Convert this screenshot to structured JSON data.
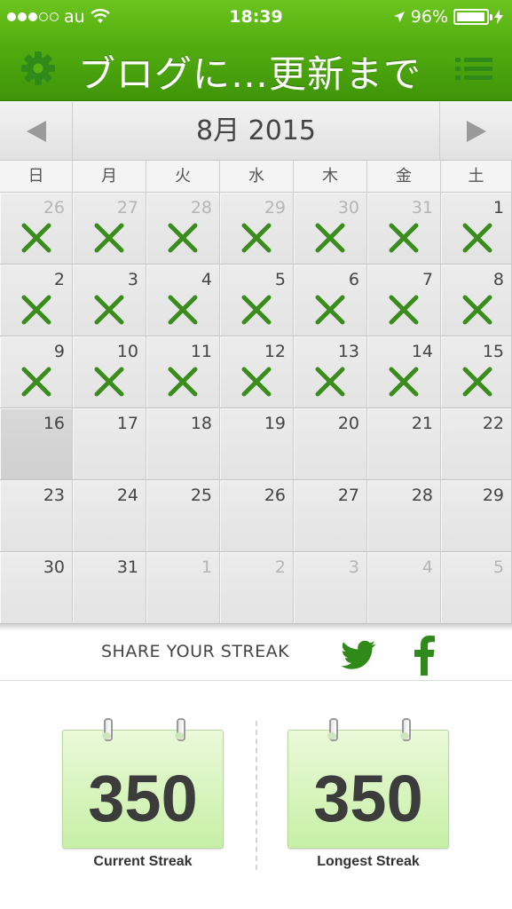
{
  "status_bar": {
    "carrier": "au",
    "time": "18:39",
    "battery": "96%",
    "battery_level": 0.96,
    "signal_bars": 3
  },
  "navbar": {
    "title": "ブログに…更新まで",
    "left_icon": "gear-icon",
    "right_icon": "list-icon"
  },
  "calendar": {
    "month_label": "8月 2015",
    "weekdays": [
      "日",
      "月",
      "火",
      "水",
      "木",
      "金",
      "土"
    ],
    "weeks": [
      [
        {
          "day": "26",
          "other": true,
          "marked": true
        },
        {
          "day": "27",
          "other": true,
          "marked": true
        },
        {
          "day": "28",
          "other": true,
          "marked": true
        },
        {
          "day": "29",
          "other": true,
          "marked": true
        },
        {
          "day": "30",
          "other": true,
          "marked": true
        },
        {
          "day": "31",
          "other": true,
          "marked": true
        },
        {
          "day": "1",
          "other": false,
          "marked": true
        }
      ],
      [
        {
          "day": "2",
          "other": false,
          "marked": true
        },
        {
          "day": "3",
          "other": false,
          "marked": true
        },
        {
          "day": "4",
          "other": false,
          "marked": true
        },
        {
          "day": "5",
          "other": false,
          "marked": true
        },
        {
          "day": "6",
          "other": false,
          "marked": true
        },
        {
          "day": "7",
          "other": false,
          "marked": true
        },
        {
          "day": "8",
          "other": false,
          "marked": true
        }
      ],
      [
        {
          "day": "9",
          "other": false,
          "marked": true
        },
        {
          "day": "10",
          "other": false,
          "marked": true
        },
        {
          "day": "11",
          "other": false,
          "marked": true
        },
        {
          "day": "12",
          "other": false,
          "marked": true
        },
        {
          "day": "13",
          "other": false,
          "marked": true
        },
        {
          "day": "14",
          "other": false,
          "marked": true
        },
        {
          "day": "15",
          "other": false,
          "marked": true
        }
      ],
      [
        {
          "day": "16",
          "other": false,
          "marked": false,
          "today": true
        },
        {
          "day": "17",
          "other": false,
          "marked": false
        },
        {
          "day": "18",
          "other": false,
          "marked": false
        },
        {
          "day": "19",
          "other": false,
          "marked": false
        },
        {
          "day": "20",
          "other": false,
          "marked": false
        },
        {
          "day": "21",
          "other": false,
          "marked": false
        },
        {
          "day": "22",
          "other": false,
          "marked": false
        }
      ],
      [
        {
          "day": "23",
          "other": false,
          "marked": false
        },
        {
          "day": "24",
          "other": false,
          "marked": false
        },
        {
          "day": "25",
          "other": false,
          "marked": false
        },
        {
          "day": "26",
          "other": false,
          "marked": false
        },
        {
          "day": "27",
          "other": false,
          "marked": false
        },
        {
          "day": "28",
          "other": false,
          "marked": false
        },
        {
          "day": "29",
          "other": false,
          "marked": false
        }
      ],
      [
        {
          "day": "30",
          "other": false,
          "marked": false
        },
        {
          "day": "31",
          "other": false,
          "marked": false
        },
        {
          "day": "1",
          "other": true,
          "marked": false
        },
        {
          "day": "2",
          "other": true,
          "marked": false
        },
        {
          "day": "3",
          "other": true,
          "marked": false
        },
        {
          "day": "4",
          "other": true,
          "marked": false
        },
        {
          "day": "5",
          "other": true,
          "marked": false
        }
      ]
    ]
  },
  "share": {
    "label": "SHARE YOUR STREAK",
    "twitter_icon": "twitter-icon",
    "facebook_icon": "facebook-icon"
  },
  "streaks": {
    "current": {
      "value": "350",
      "label": "Current Streak"
    },
    "longest": {
      "value": "350",
      "label": "Longest Streak"
    }
  },
  "colors": {
    "header_green": "#52ad10",
    "mark_green": "#3a8d1c",
    "icon_green": "#2f8a1a",
    "card_green": "#c7f0a6"
  }
}
